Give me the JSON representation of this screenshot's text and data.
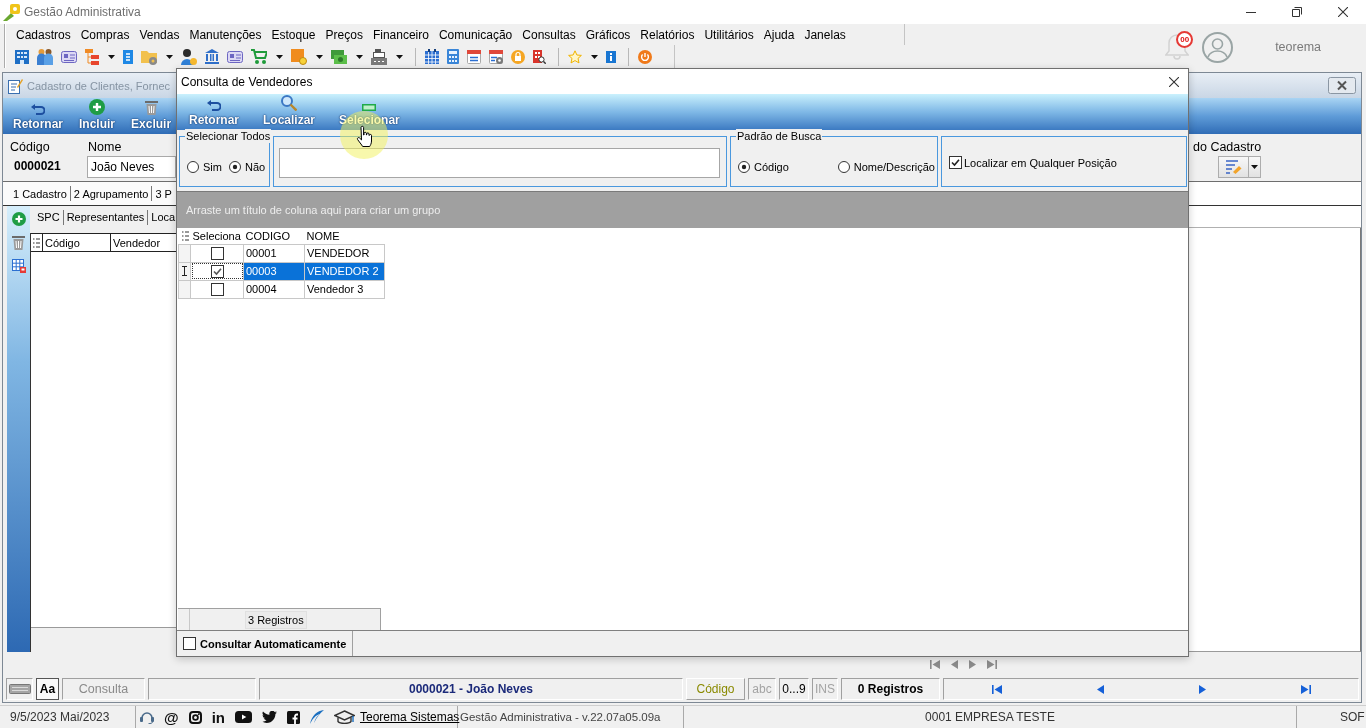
{
  "window": {
    "title": "Gestão Administrativa"
  },
  "menu": [
    "Cadastros",
    "Compras",
    "Vendas",
    "Manutenções",
    "Estoque",
    "Preços",
    "Financeiro",
    "Comunicação",
    "Consultas",
    "Gráficos",
    "Relatórios",
    "Utilitários",
    "Ajuda",
    "Janelas"
  ],
  "notifications": {
    "count": "00"
  },
  "user": {
    "name": "teorema"
  },
  "client_window": {
    "title": "Cadastro de Clientes, Fornec",
    "toolbar": [
      "Retornar",
      "Incluir",
      "Excluir"
    ],
    "code": {
      "label": "Código",
      "value": "0000021"
    },
    "name": {
      "label": "Nome",
      "value": "João Neves"
    },
    "side_label": "do Cadastro",
    "tabs": [
      "1 Cadastro",
      "2 Agrupamento",
      "3 P"
    ],
    "subtabs": [
      "SPC",
      "Representantes",
      "Loca"
    ],
    "grid_columns": [
      "Código",
      "Vendedor"
    ],
    "status_bar": {
      "font_button": "Aa",
      "mode": "Consulta",
      "record": "0000021 - João Neves",
      "search_field": "Código",
      "indicators": [
        {
          "label": "abc",
          "on": false
        },
        {
          "label": "0...9",
          "on": true
        },
        {
          "label": "INS",
          "on": false
        }
      ],
      "count": "0 Registros"
    }
  },
  "dialog": {
    "title": "Consulta de Vendedores",
    "toolbar": [
      "Retornar",
      "Localizar",
      "Selecionar"
    ],
    "select_all": {
      "title": "Selecionar Todos",
      "options": [
        {
          "label": "Sim",
          "selected": false
        },
        {
          "label": "Não",
          "selected": true
        }
      ]
    },
    "search_mode": {
      "title": "Padrão de Busca",
      "options": [
        {
          "label": "Código",
          "selected": true
        },
        {
          "label": "Nome/Descrição",
          "selected": false
        }
      ]
    },
    "match_anywhere": {
      "label": "Localizar em Qualquer Posição",
      "checked": true
    },
    "group_panel": "Arraste um título de coluna aqui para criar um grupo",
    "table": {
      "columns": [
        "Seleciona",
        "CODIGO",
        "NOME"
      ],
      "rows": [
        {
          "checked": false,
          "selected": false,
          "code": "00001",
          "name": "VENDEDOR"
        },
        {
          "checked": true,
          "selected": true,
          "code": "00003",
          "name": "VENDEDOR 2"
        },
        {
          "checked": false,
          "selected": false,
          "code": "00004",
          "name": "Vendedor 3"
        }
      ],
      "footer": "3 Registros"
    },
    "auto_query": {
      "label": "Consultar Automaticamente",
      "checked": false
    }
  },
  "status_bar": {
    "date": "9/5/2023 Mai/2023",
    "email_glyph": "@",
    "linkedin_glyph": "in",
    "link": "Teorema Sistemas",
    "version": "Gestão Administrativa - v.22.07a05.09a",
    "company": "0001 EMPRESA TESTE",
    "user": "SOF"
  }
}
